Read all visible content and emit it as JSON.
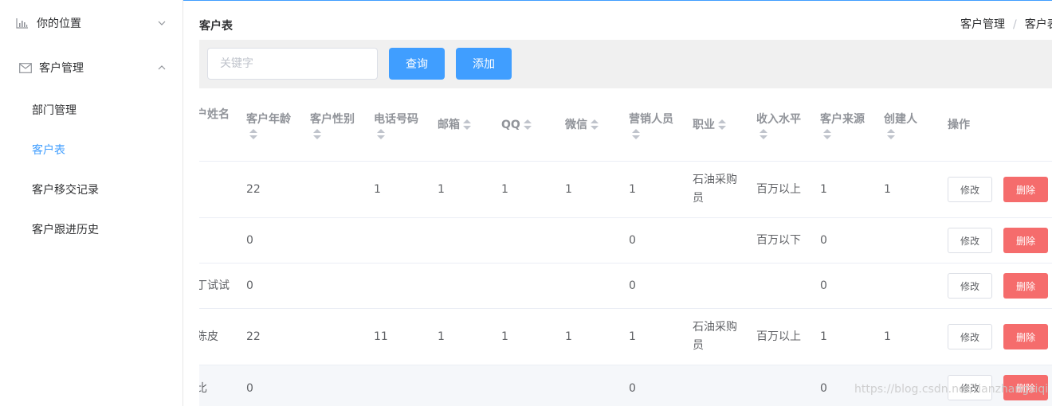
{
  "sidebar": {
    "location": {
      "label": "你的位置",
      "icon": "bar-chart-icon"
    },
    "customer_mgmt": {
      "label": "客户管理",
      "icon": "mail-icon"
    },
    "items": [
      {
        "label": "部门管理"
      },
      {
        "label": "客户表"
      },
      {
        "label": "客户移交记录"
      },
      {
        "label": "客户跟进历史"
      }
    ]
  },
  "page": {
    "title": "客户表"
  },
  "breadcrumb": {
    "root": "客户管理",
    "separator": "/",
    "current": "客户表"
  },
  "toolbar": {
    "search_placeholder": "关键字",
    "search_value": "",
    "query_label": "查询",
    "add_label": "添加"
  },
  "table": {
    "headers": {
      "name": "户姓名",
      "age": "客户年龄",
      "gender": "客户性别",
      "phone": "电话号码",
      "email": "邮箱",
      "qq": "QQ",
      "wechat": "微信",
      "sales": "营销人员",
      "job": "职业",
      "income": "收入水平",
      "source": "客户来源",
      "creator": "创建人",
      "ops": "操作"
    },
    "rows": [
      {
        "name": "",
        "age": "22",
        "gender": "",
        "phone": "1",
        "email": "1",
        "qq": "1",
        "wechat": "1",
        "sales": "1",
        "job": "石油采购员",
        "income": "百万以上",
        "source": "1",
        "creator": "1"
      },
      {
        "name": "",
        "age": "0",
        "gender": "",
        "phone": "",
        "email": "",
        "qq": "",
        "wechat": "",
        "sales": "0",
        "job": "",
        "income": "百万以下",
        "source": "0",
        "creator": ""
      },
      {
        "name": "丁试试",
        "age": "0",
        "gender": "",
        "phone": "",
        "email": "",
        "qq": "",
        "wechat": "",
        "sales": "0",
        "job": "",
        "income": "",
        "source": "0",
        "creator": ""
      },
      {
        "name": "陈皮",
        "age": "22",
        "gender": "",
        "phone": "11",
        "email": "1",
        "qq": "1",
        "wechat": "1",
        "sales": "1",
        "job": "石油采购员",
        "income": "百万以上",
        "source": "1",
        "creator": "1"
      },
      {
        "name": "比",
        "age": "0",
        "gender": "",
        "phone": "",
        "email": "",
        "qq": "",
        "wechat": "",
        "sales": "0",
        "job": "",
        "income": "",
        "source": "0",
        "creator": ""
      }
    ],
    "edit_label": "修改",
    "delete_label": "删除"
  },
  "watermark": "https://blog.csdn.net/tianzhangsiqi",
  "colors": {
    "primary": "#409eff",
    "danger": "#f56c6c",
    "toolbar_bg": "#f0f0f0"
  }
}
